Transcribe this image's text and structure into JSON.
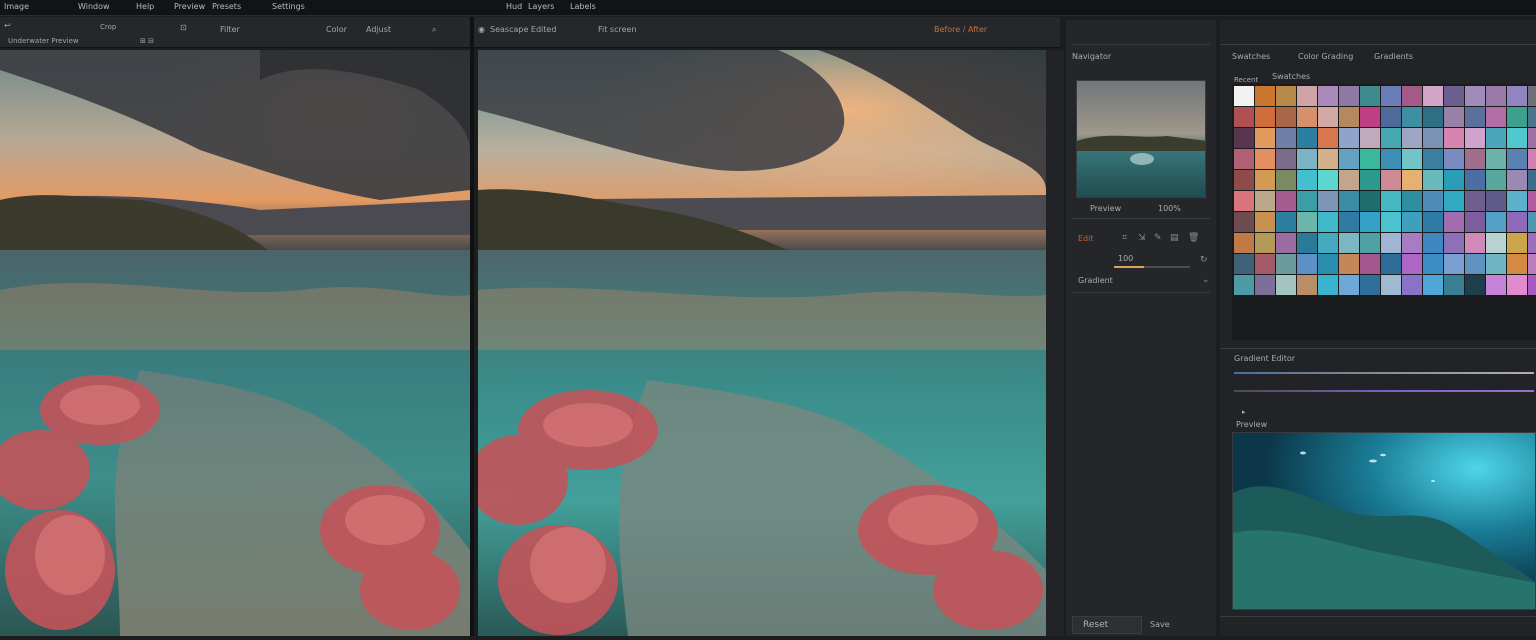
{
  "menubar": {
    "items": [
      "Image",
      "Window",
      "Help",
      "Preview",
      "Presets",
      "Settings"
    ],
    "right_items": [
      "Hud",
      "Layers",
      "Labels"
    ]
  },
  "left_doc": {
    "tab": "Underwater Preview",
    "tools": [
      "Crop",
      "Adjust",
      "Filter",
      "Color"
    ]
  },
  "right_doc": {
    "tab": "Seascape Edited",
    "zoom": "Fit screen",
    "mode": "Before / After"
  },
  "tools_panel": {
    "header": "Navigator",
    "thumbnail_label": "Preview",
    "thumbnail_value": "100%",
    "section_label": "Edit",
    "value": "100",
    "adjust_label": "Gradient"
  },
  "swatches_panel": {
    "tabs": [
      "Swatches",
      "Color Grading",
      "Gradients"
    ],
    "sub": "Recent",
    "title": "Swatches",
    "colors": [
      [
        "#f2f2f2",
        "#c9772f",
        "#b4894a",
        "#d0a4a6",
        "#a98ab8",
        "#8f79a4",
        "#3e8a8c",
        "#6a7db8",
        "#a35a86",
        "#d3a5c6",
        "#6c5e8e",
        "#a08bb9",
        "#9a79a8",
        "#9185c0",
        "#707079"
      ],
      [
        "#b05050",
        "#d16d3a",
        "#a86848",
        "#d8906c",
        "#d3a9a6",
        "#b68860",
        "#c03e86",
        "#4e6a9a",
        "#3e8fa3",
        "#2e6f84",
        "#9a81a8",
        "#5b709c",
        "#b26ea4",
        "#3f9f8d",
        "#4a758d"
      ],
      [
        "#5a3550",
        "#e19b5c",
        "#6f7fa8",
        "#2c7fa2",
        "#d8764d",
        "#8fa4ca",
        "#bfa9ba",
        "#46a9b1",
        "#9da6c2",
        "#7a93b5",
        "#d784b0",
        "#cfa3cc",
        "#4aa5bd",
        "#4fc7cf",
        "#9d6fa5"
      ],
      [
        "#b15f72",
        "#e48f5e",
        "#7b6a8a",
        "#7ab4c5",
        "#d4b08a",
        "#64a2c1",
        "#3ab89e",
        "#3d8eb4",
        "#72c4c9",
        "#3b7fa0",
        "#7b8bc2",
        "#a06d8d",
        "#6bb3a8",
        "#5a82b1",
        "#cf80b0"
      ],
      [
        "#8f4a4a",
        "#d29a52",
        "#7c8a63",
        "#42c0cf",
        "#5cd6cf",
        "#c2a58b",
        "#2d9a8e",
        "#cf8b95",
        "#e5b16e",
        "#69b9bd",
        "#2a9eb6",
        "#4b6fa3",
        "#57a79d",
        "#9a88b5",
        "#3f6d8c"
      ],
      [
        "#d9747a",
        "#bba78a",
        "#a45d91",
        "#3b9da5",
        "#7c97b5",
        "#3a8ca7",
        "#1f6d6e",
        "#47b8c1",
        "#2d8fa0",
        "#4f8bb5",
        "#33a8c3",
        "#6e5f8c",
        "#5f5b88",
        "#5cb0c9",
        "#b15aa0"
      ],
      [
        "#6d4b4f",
        "#c8914f",
        "#2e7ea0",
        "#6bb6aa",
        "#3fb8c9",
        "#2f7ba4",
        "#33a2c6",
        "#4bc3d1",
        "#3ea0be",
        "#2e7ca5",
        "#a46cb0",
        "#7e5d9e",
        "#53a1c6",
        "#8f6ab8",
        "#4d97b2"
      ],
      [
        "#c07a46",
        "#b49a56",
        "#9b6ca2",
        "#2a7b97",
        "#45aac0",
        "#7ab7c3",
        "#4fa1a6",
        "#9fb5d2",
        "#a87cc2",
        "#3f87c0",
        "#8e70b8",
        "#d189b8",
        "#b9d3d0",
        "#cca54a",
        "#9b6fbc"
      ],
      [
        "#3e627a",
        "#a45a69",
        "#6a9c9d",
        "#5f8fc8",
        "#2a8eaf",
        "#c38759",
        "#a2578e",
        "#2d6c96",
        "#ad67c8",
        "#3c8dc3",
        "#7a9fd2",
        "#5d93be",
        "#6fb5c2",
        "#d48a40",
        "#bc7cc0"
      ],
      [
        "#4c9aa6",
        "#7c6f9a",
        "#a3c4c0",
        "#b98e66",
        "#3ab3cc",
        "#6fa7d8",
        "#2e6f9b",
        "#9fbad0",
        "#8a72c7",
        "#4ea7d6",
        "#3a7e93",
        "#1e3e4e",
        "#c584d8",
        "#e08bd0",
        "#a85ac4"
      ]
    ]
  },
  "gradient_panel": {
    "label": "Gradient Editor"
  },
  "preview_panel": {
    "label": "Preview"
  },
  "bottom": {
    "button": "Reset",
    "extra": "Save"
  }
}
